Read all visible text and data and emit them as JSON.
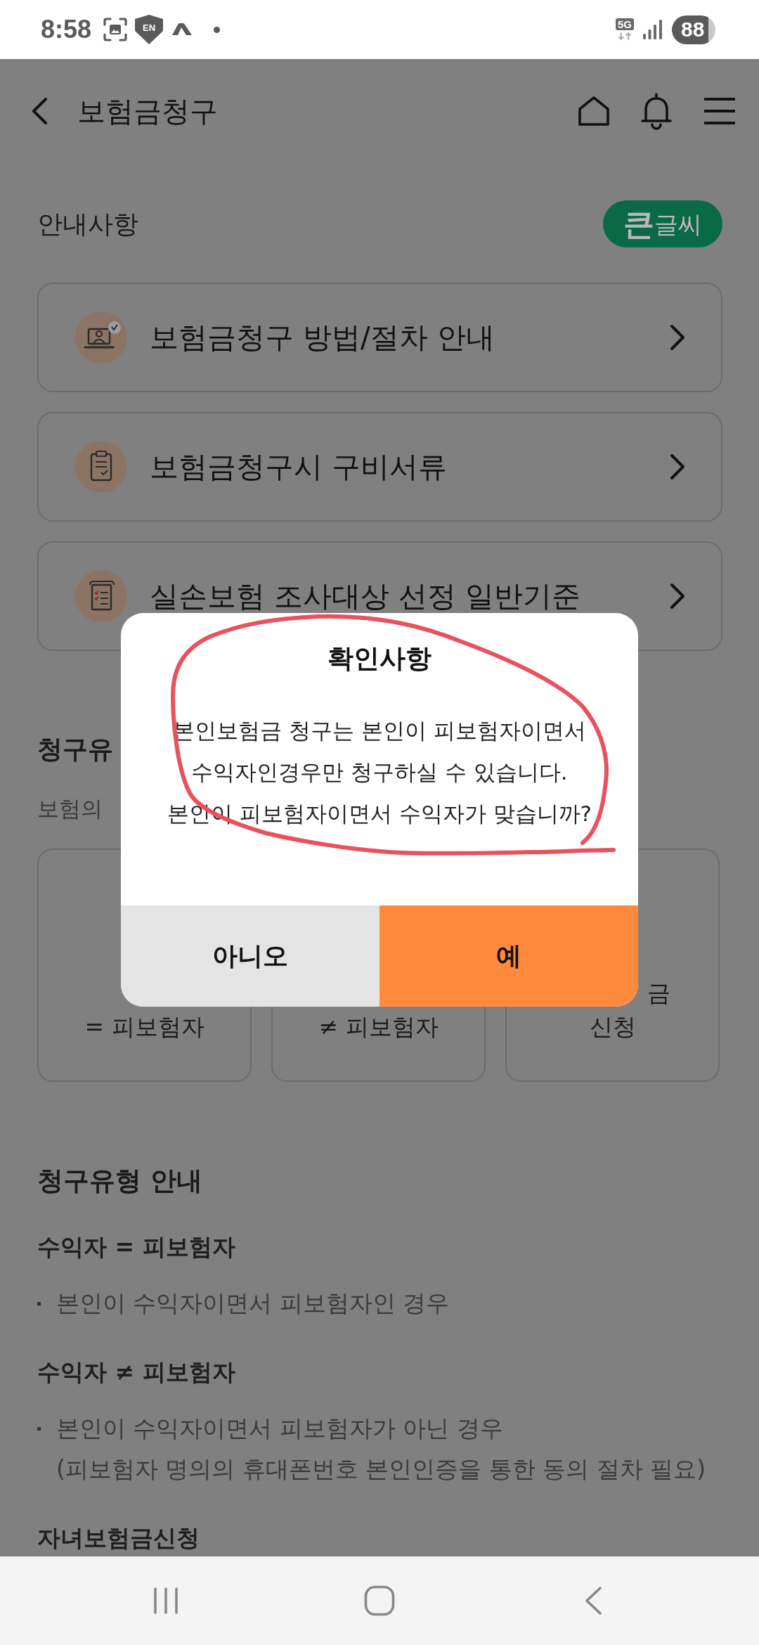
{
  "status_bar": {
    "time": "8:58",
    "vpn_label": "EN",
    "network": "5G",
    "battery": "88"
  },
  "header": {
    "title": "보험금청구"
  },
  "notices": {
    "title": "안내사항",
    "large_text_button": "**큰**글씨",
    "items": [
      {
        "kind": "guide",
        "label": "보험금청구 방법/절차 안내"
      },
      {
        "kind": "documents",
        "label": "보험금청구시 구비서류"
      },
      {
        "kind": "criteria",
        "label": "실손보험 조사대상 선정 일반기준"
      }
    ]
  },
  "claim_types": {
    "title": "청구유",
    "subtitle": "보험의",
    "cards": [
      {
        "line_2": "= 피보험자"
      },
      {
        "line_2": "≠ 피보험자"
      },
      {
        "line_1": "금",
        "line_2": "신청"
      }
    ]
  },
  "claim_type_guide": {
    "title": "청구유형 안내",
    "groups": [
      {
        "heading": "수익자 = 피보험자",
        "bullets": [
          "본인이 수익자이면서 피보험자인 경우"
        ]
      },
      {
        "heading": "수익자 ≠ 피보험자",
        "bullets": [
          "본인이 수익자이면서 피보험자가 아닌 경우\n(피보험자 명의의 휴대폰번호 본인인증을 통한 동의 절차 필요)"
        ]
      },
      {
        "heading": "자녀보험금신청"
      }
    ]
  },
  "dialog": {
    "title": "확인사항",
    "message": "본인보험금 청구는 본인이 피보험자이면서\n수익자인경우만 청구하실 수 있습니다.\n본인이 피보험자이면서 수익자가 맞습니까?",
    "buttons": [
      {
        "kind": "secondary",
        "label": "아니오"
      },
      {
        "kind": "primary",
        "label": "예"
      }
    ]
  }
}
